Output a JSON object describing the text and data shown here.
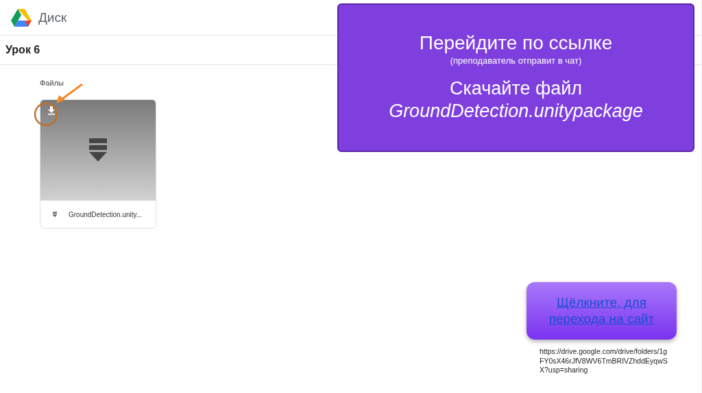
{
  "header": {
    "app_name": "Диск"
  },
  "breadcrumb": {
    "title": "Урок 6"
  },
  "files_section": {
    "label": "Файлы",
    "files": [
      {
        "name": "GroundDetection.unity..."
      }
    ]
  },
  "callout": {
    "heading": "Перейдите по ссылке",
    "note": "(преподаватель отправит в чат)",
    "action": "Скачайте файл",
    "filename": "GroundDetection.unitypackage"
  },
  "link_button": {
    "label": "Щёлкните, для перехода на сайт"
  },
  "url": "https://drive.google.com/drive/folders/1gFY0sX46rJfV8WV6TmBRIVZhddEyqwSX?usp=sharing"
}
